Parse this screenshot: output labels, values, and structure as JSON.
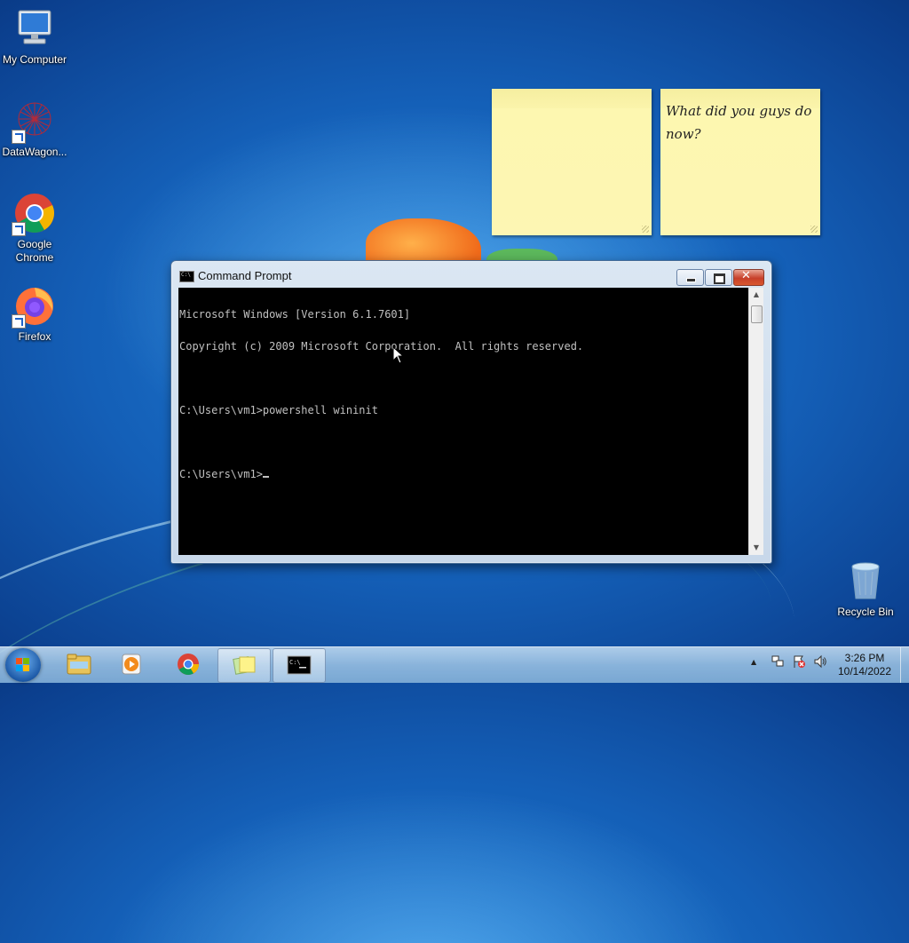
{
  "desktop": {
    "icons": [
      {
        "label": "My Computer"
      },
      {
        "label": "DataWagon..."
      },
      {
        "label": "Google Chrome"
      },
      {
        "label": "Firefox"
      },
      {
        "label": "Recycle Bin"
      }
    ]
  },
  "sticky_notes": [
    {
      "text": ""
    },
    {
      "text": "What did you guys do now?"
    }
  ],
  "window": {
    "title": "Command Prompt",
    "console_lines": [
      "Microsoft Windows [Version 6.1.7601]",
      "Copyright (c) 2009 Microsoft Corporation.  All rights reserved.",
      "",
      "C:\\Users\\vm1>powershell wininit",
      "",
      "C:\\Users\\vm1>"
    ],
    "close_symbol": "✕"
  },
  "taskbar": {
    "clock_time": "3:26 PM",
    "clock_date": "10/14/2022",
    "tray_arrow": "▲"
  },
  "colors": {
    "desktop_blue": "#145fb7",
    "console_bg": "#000000",
    "console_fg": "#c0c0c0",
    "sticky_yellow": "#fdf6b3",
    "close_red": "#c7402a"
  }
}
